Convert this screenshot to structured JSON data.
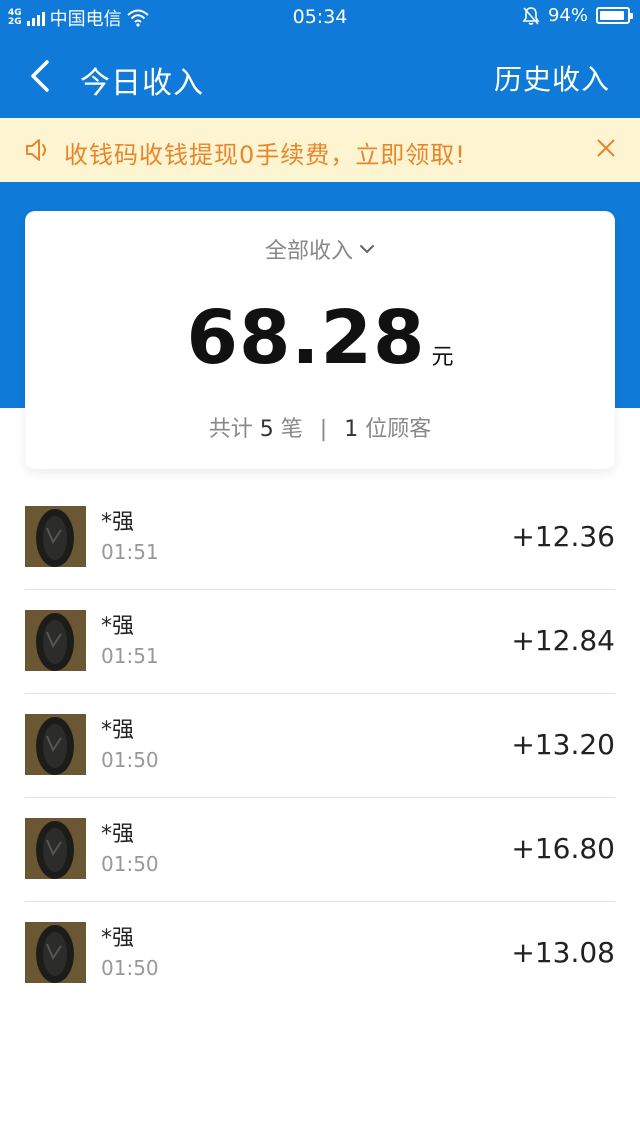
{
  "status_bar": {
    "network_type_top": "4G",
    "network_type_bottom": "2G",
    "carrier": "中国电信",
    "time": "05:34",
    "battery": "94%",
    "battery_level": 0.94
  },
  "header": {
    "title": "今日收入",
    "history_label": "历史收入"
  },
  "notice": {
    "text": "收钱码收钱提现0手续费，立即领取!"
  },
  "summary": {
    "filter_label": "全部收入",
    "total_amount": "68.28",
    "unit": "元",
    "count_prefix": "共计",
    "count_value": "5",
    "count_unit": "笔",
    "separator": "|",
    "customer_value": "1",
    "customer_label": "位顾客"
  },
  "transactions": [
    {
      "name": "*强",
      "time": "01:51",
      "amount": "+12.36"
    },
    {
      "name": "*强",
      "time": "01:51",
      "amount": "+12.84"
    },
    {
      "name": "*强",
      "time": "01:50",
      "amount": "+13.20"
    },
    {
      "name": "*强",
      "time": "01:50",
      "amount": "+16.80"
    },
    {
      "name": "*强",
      "time": "01:50",
      "amount": "+13.08"
    }
  ],
  "colors": {
    "primary_blue": "#0f7ad8",
    "notice_bg": "#fdf4d2",
    "notice_text": "#e8862a"
  },
  "icons": {
    "back": "chevron-left-icon",
    "speaker": "speaker-icon",
    "close": "close-icon",
    "dropdown": "chevron-down-icon",
    "avatar": "avatar-image"
  }
}
